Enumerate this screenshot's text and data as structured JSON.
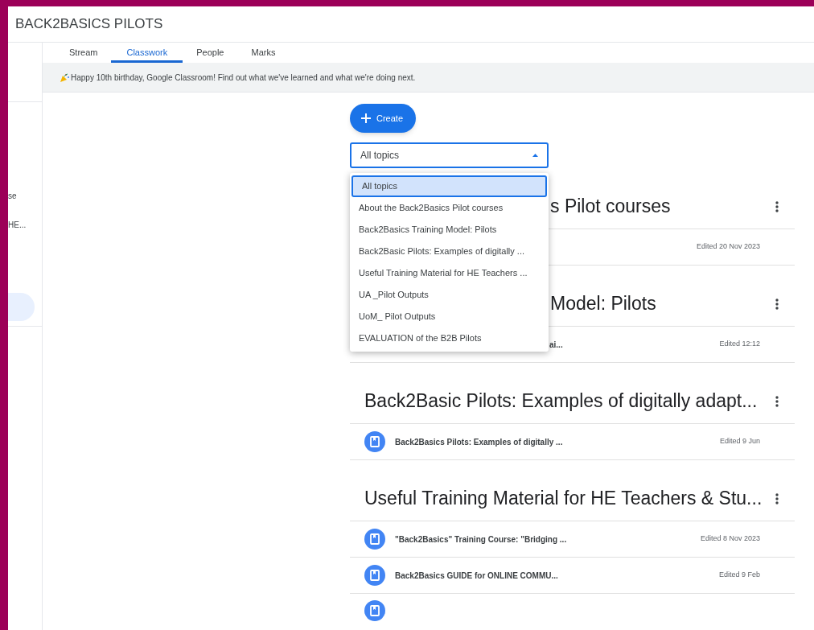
{
  "class_title": "BACK2BASICS PILOTS",
  "tabs": [
    {
      "label": "Stream",
      "selected": false
    },
    {
      "label": "Classwork",
      "selected": true
    },
    {
      "label": "People",
      "selected": false
    },
    {
      "label": "Marks",
      "selected": false
    }
  ],
  "sidebar": {
    "items": [
      {
        "label": "se"
      },
      {
        "label": "HE..."
      }
    ]
  },
  "banner": {
    "text": "Happy 10th birthday, Google Classroom! Find out what we've learned and what we're doing next."
  },
  "create_button": {
    "label": "Create"
  },
  "topic_filter": {
    "value": "All topics",
    "expanded": true,
    "options": [
      {
        "label": "All topics",
        "selected": true
      },
      {
        "label": "About the Back2Basics Pilot courses",
        "selected": false
      },
      {
        "label": "Back2Basics Training Model: Pilots",
        "selected": false
      },
      {
        "label": "Back2Basic Pilots: Examples of digitally ...",
        "selected": false
      },
      {
        "label": "Useful Training Material for HE Teachers ...",
        "selected": false
      },
      {
        "label": "UA _Pilot Outputs",
        "selected": false
      },
      {
        "label": "UoM_ Pilot Outputs",
        "selected": false
      },
      {
        "label": "EVALUATION of the B2B Pilots",
        "selected": false
      }
    ]
  },
  "topics": [
    {
      "heading": "s Pilot courses",
      "partly_hidden": true,
      "items": [
        {
          "edited": "Edited 20 Nov 2023"
        }
      ]
    },
    {
      "heading": "Model: Pilots",
      "partly_hidden": true,
      "items": [
        {
          "title": "ai...",
          "edited": "Edited 12:12",
          "partly_hidden": true
        }
      ]
    },
    {
      "heading": "Back2Basic Pilots: Examples of digitally adapt...",
      "partly_hidden": false,
      "items": [
        {
          "title": "Back2Basics Pilots: Examples of digitally ...",
          "edited": "Edited 9 Jun"
        }
      ]
    },
    {
      "heading": "Useful Training Material for HE Teachers & Stu...",
      "partly_hidden": false,
      "more_below": true,
      "items": [
        {
          "title": "\"Back2Basics\" Training Course: \"Bridging ...",
          "edited": "Edited 8 Nov 2023"
        },
        {
          "title": "Back2Basics GUIDE for ONLINE COMMU...",
          "edited": "Edited 9 Feb"
        }
      ]
    }
  ]
}
